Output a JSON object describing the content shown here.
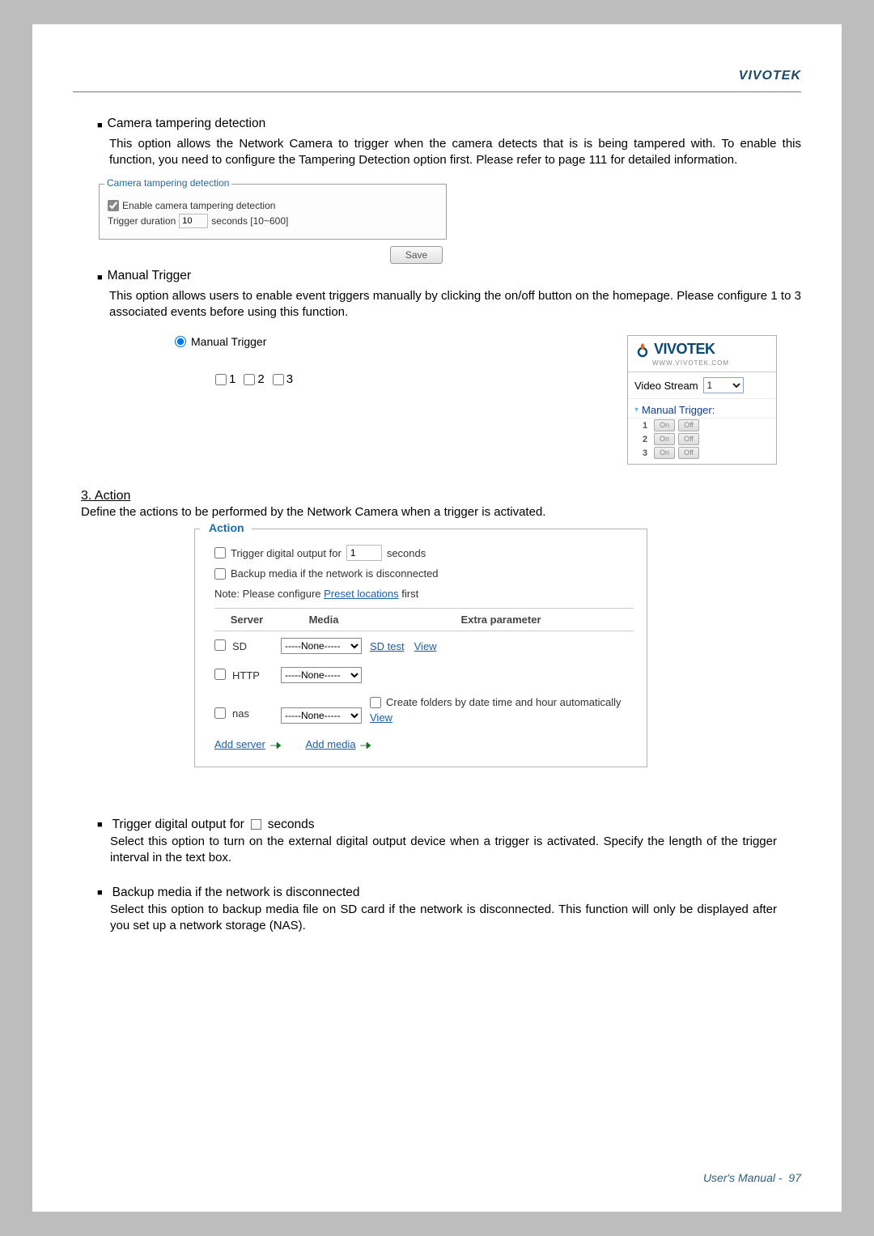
{
  "brand": "VIVOTEK",
  "brand_sub": "WWW.VIVOTEK.COM",
  "tampering": {
    "title": "Camera tampering detection",
    "desc": "This option allows the Network Camera to trigger when the camera detects that is is being tampered with. To enable this function, you need to configure the Tampering Detection option first. Please refer to page 111 for detailed information.",
    "fieldset_legend": "Camera tampering detection",
    "enable_label": "Enable camera tampering detection",
    "duration_label": "Trigger duration",
    "duration_value": "10",
    "duration_suffix": "seconds [10~600]",
    "save_label": "Save"
  },
  "manual": {
    "title": "Manual Trigger",
    "desc": "This option allows users to enable event triggers manually by clicking the on/off button on the homepage. Please configure 1 to 3 associated events before using this function.",
    "radio_label": "Manual Trigger",
    "options": {
      "a": "1",
      "b": "2",
      "c": "3"
    }
  },
  "widget": {
    "video_stream_label": "Video Stream",
    "video_stream_value": "1",
    "mt_label": "Manual Trigger:",
    "rows": [
      {
        "n": "1",
        "on": "On",
        "off": "Off"
      },
      {
        "n": "2",
        "on": "On",
        "off": "Off"
      },
      {
        "n": "3",
        "on": "On",
        "off": "Off"
      }
    ]
  },
  "action_heading": "3. Action",
  "action_intro": "Define the actions to be performed by the Network Camera when a trigger is activated.",
  "action": {
    "legend": "Action",
    "digital_out_pre": "Trigger digital output for",
    "digital_out_value": "1",
    "digital_out_post": "seconds",
    "backup_label": "Backup media if the network is disconnected",
    "note_pre": "Note: Please configure ",
    "note_link": "Preset locations",
    "note_post": " first",
    "th_server": "Server",
    "th_media": "Media",
    "th_extra": "Extra parameter",
    "none_option": "-----None-----",
    "servers": {
      "sd": {
        "label": "SD",
        "sdtest": "SD test",
        "view": "View"
      },
      "http": {
        "label": "HTTP"
      },
      "nas": {
        "label": "nas",
        "auto_folder": "Create folders by date time and hour automatically",
        "view": "View"
      }
    },
    "add_server": "Add server",
    "add_media": "Add media"
  },
  "lower": {
    "digital": {
      "title_pre": "Trigger digital output for ",
      "title_post": " seconds",
      "body": "Select this option to turn on the external digital output device when a trigger is activated. Specify the length of the trigger interval in the text box."
    },
    "backup": {
      "title": "Backup media if the network is disconnected",
      "body": "Select this option to backup media file on SD card if the network is disconnected. This function will only be displayed after you set up a network storage (NAS)."
    }
  },
  "footer": {
    "text": "User's Manual - ",
    "page": "97"
  }
}
